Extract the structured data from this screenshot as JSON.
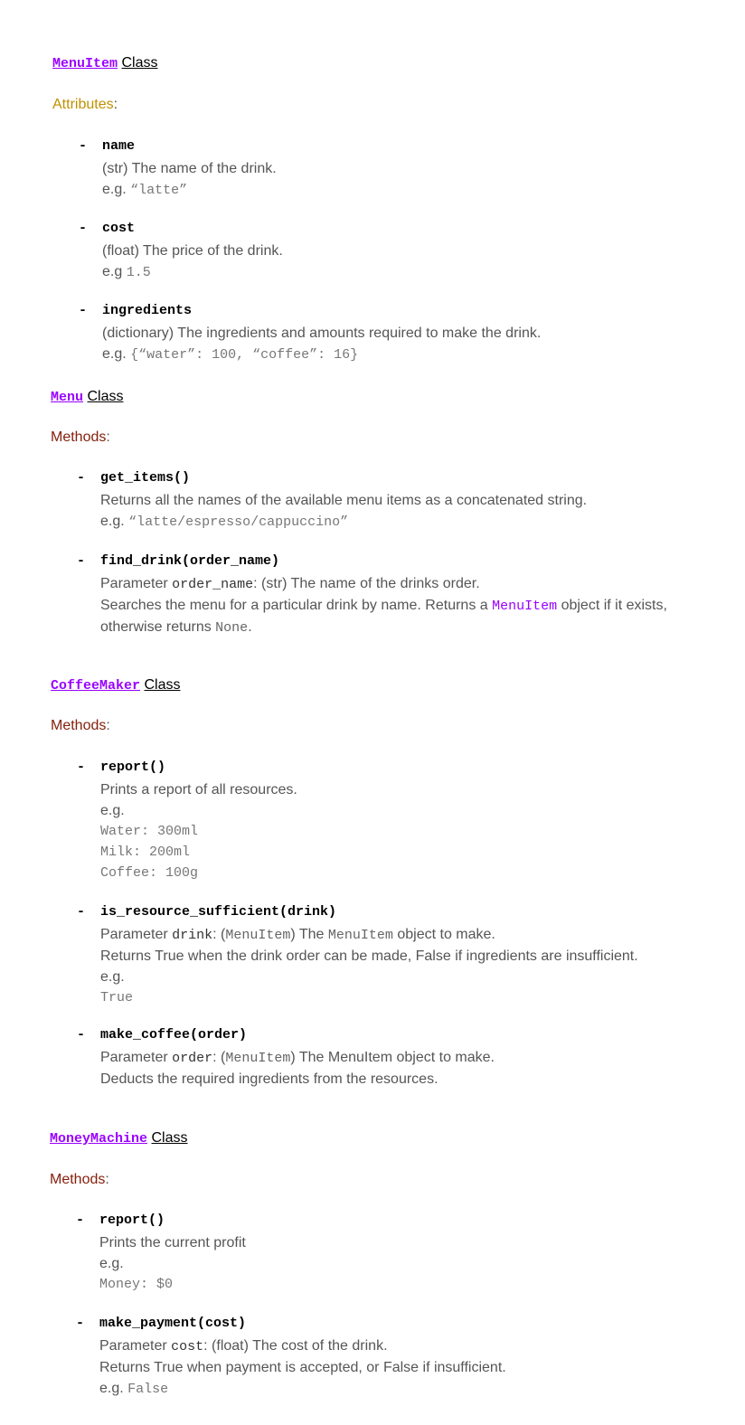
{
  "menuitem": {
    "class_code": "MenuItem",
    "class_word": "Class",
    "label": "Attributes",
    "colon": ":",
    "items": [
      {
        "name": "name",
        "desc": "(str) The name of the drink.",
        "eg_prefix": "e.g. ",
        "eg_code": "“latte”"
      },
      {
        "name": "cost",
        "desc": "(float) The price of the drink.",
        "eg_prefix": "e.g ",
        "eg_code": "1.5"
      },
      {
        "name": "ingredients",
        "desc": "(dictionary) The ingredients and amounts required to make the drink.",
        "eg_prefix": "e.g. ",
        "eg_code": "{“water”: 100, “coffee”: 16}"
      }
    ]
  },
  "menu": {
    "class_code": "Menu",
    "class_word": "Class",
    "label": "Methods",
    "colon": ":",
    "get_items": {
      "sig": "get_items()",
      "desc": "Returns all the names of the available menu items as a concatenated string.",
      "eg_prefix": "e.g. ",
      "eg_code": "“latte/espresso/cappuccino”"
    },
    "find_drink": {
      "sig": "find_drink(order_name)",
      "param_prefix": "Parameter ",
      "param_code": "order_name",
      "param_rest": ": (str) The name of the drinks order.",
      "desc_prefix": "Searches the menu for a particular drink by name. Returns a ",
      "desc_code": "MenuItem",
      "desc_suffix": " object if it exists,",
      "line2_prefix": "otherwise returns ",
      "line2_code": "None",
      "line2_suffix": "."
    }
  },
  "coffeemaker": {
    "class_code": "CoffeeMaker",
    "class_word": "Class",
    "label": "Methods",
    "colon": ":",
    "report": {
      "sig": "report()",
      "desc": "Prints a report of all resources.",
      "eg": "e.g.",
      "lines": [
        "Water: 300ml",
        "Milk: 200ml",
        "Coffee: 100g"
      ]
    },
    "is_resource_sufficient": {
      "sig": "is_resource_sufficient(drink)",
      "param_prefix": "Parameter ",
      "param_code": "drink",
      "param_mid": ": (",
      "param_type": "MenuItem",
      "param_mid2": ") The ",
      "param_code2": "MenuItem",
      "param_rest": " object to make.",
      "desc": "Returns True when the drink order can be made, False if ingredients are insufficient.",
      "eg": "e.g.",
      "eg_code": "True"
    },
    "make_coffee": {
      "sig": "make_coffee(order)",
      "param_prefix": "Parameter ",
      "param_code": "order",
      "param_mid": ": (",
      "param_type": "MenuItem",
      "param_rest": ") The MenuItem object to make.",
      "desc": "Deducts the required ingredients from the resources."
    }
  },
  "moneymachine": {
    "class_code": "MoneyMachine",
    "class_word": "Class",
    "label": "Methods",
    "colon": ":",
    "report": {
      "sig": "report()",
      "desc": "Prints the current profit",
      "eg": "e.g.",
      "eg_code": "Money: $0"
    },
    "make_payment": {
      "sig": "make_payment(cost)",
      "param_prefix": "Parameter ",
      "param_code": "cost",
      "param_rest": ": (float) The cost of the drink.",
      "desc": "Returns True when payment is accepted, or False if insufficient.",
      "eg_prefix": "e.g. ",
      "eg_code": "False"
    }
  },
  "bullet": "-"
}
